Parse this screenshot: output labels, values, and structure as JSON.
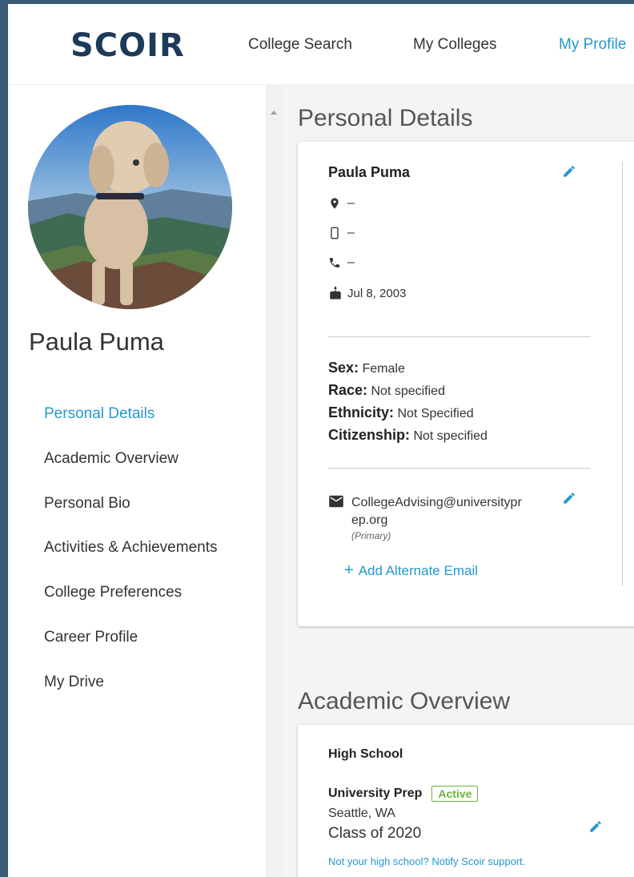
{
  "nav": {
    "logo": "SCOIR",
    "links": [
      "College Search",
      "My Colleges",
      "My Profile"
    ],
    "active_index": 2
  },
  "sidebar": {
    "name": "Paula Puma",
    "items": [
      "Personal Details",
      "Academic Overview",
      "Personal Bio",
      "Activities & Achievements",
      "College Preferences",
      "Career Profile",
      "My Drive"
    ],
    "active_index": 0
  },
  "personal": {
    "section_title": "Personal Details",
    "name": "Paula Puma",
    "location": "–",
    "mobile": "–",
    "phone": "–",
    "birthday": "Jul 8, 2003",
    "sex_label": "Sex:",
    "sex": "Female",
    "race_label": "Race:",
    "race": "Not specified",
    "ethnicity_label": "Ethnicity:",
    "ethnicity": "Not Specified",
    "citizenship_label": "Citizenship:",
    "citizenship": "Not specified",
    "email_line1": "CollegeAdvising@universitypr",
    "email_line2": "ep.org",
    "email_tag": "(Primary)",
    "add_email": "Add Alternate Email"
  },
  "academic": {
    "section_title": "Academic Overview",
    "heading": "High School",
    "school": "University Prep",
    "status": "Active",
    "city": "Seattle, WA",
    "class_of": "Class of 2020",
    "notify": "Not your high school? Notify Scoir support."
  },
  "colors": {
    "accent": "#2598cc",
    "brand": "#1e3a5a",
    "active_badge": "#6db33f"
  }
}
